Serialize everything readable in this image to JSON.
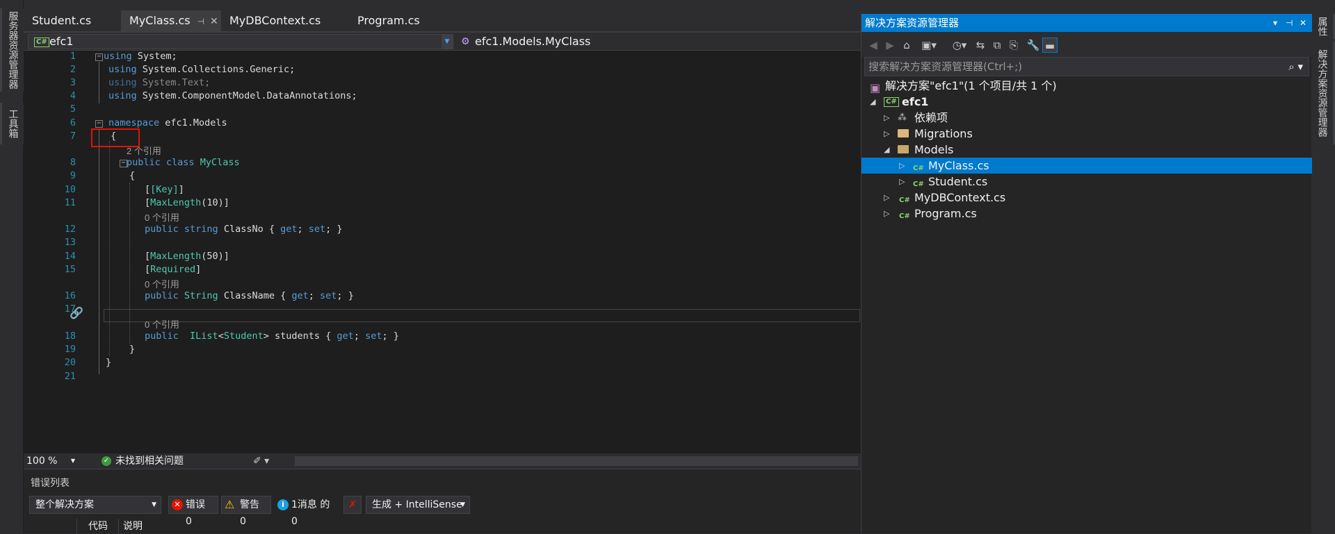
{
  "left_strip": {
    "tabs": [
      "服务器资源管理器",
      "工具箱"
    ]
  },
  "right_strip": {
    "tabs": [
      "属性",
      "解决方案资源管理器"
    ]
  },
  "doc_tabs": [
    {
      "label": "Student.cs",
      "active": false
    },
    {
      "label": "MyClass.cs",
      "active": true
    },
    {
      "label": "MyDBContext.cs",
      "active": false
    },
    {
      "label": "Program.cs",
      "active": false
    }
  ],
  "navbar": {
    "project": "efc1",
    "scope": "efc1.Models.MyClass"
  },
  "editor": {
    "line_numbers": [
      "1",
      "2",
      "3",
      "4",
      "5",
      "6",
      "7",
      "8",
      "9",
      "10",
      "11",
      "12",
      "13",
      "14",
      "15",
      "16",
      "17",
      "18",
      "19",
      "20",
      "21"
    ],
    "lens": {
      "refs2": "2 个引用",
      "refs0": "0 个引用"
    },
    "code": {
      "l1_kw": "using",
      "l1_rest": " System;",
      "l2_kw": "using",
      "l2_rest": " System.Collections.Generic;",
      "l3_kw": "using",
      "l3_rest": " System.Text;",
      "l4_kw": "using",
      "l4_rest": " System.ComponentModel.DataAnnotations;",
      "l6_kw": "namespace",
      "l6_rest": " efc1.Models",
      "open_brace": "{",
      "close_brace": "}",
      "l8_kw1": "public",
      "l8_kw2": "class",
      "l8_type": "MyClass",
      "l10": "[Key]",
      "l11_attr": "MaxLength",
      "l11_arg": "(10)]",
      "l12_kw1": "public",
      "l12_kw2": "string",
      "l12_rest": " ClassNo { ",
      "get": "get",
      "set": "set",
      "semi": "; ",
      "end": " }",
      "l14_attr": "MaxLength",
      "l14_arg": "(50)]",
      "l15": "Required",
      "l16_kw1": "public",
      "l16_type": "String",
      "l16_rest": " ClassName { ",
      "l18_kw1": "public",
      "l18_type1": "IList",
      "l18_type2": "Student",
      "l18_rest": " students { "
    }
  },
  "editor_status": {
    "zoom": "100 %",
    "issues": "未找到相关问题"
  },
  "error_list": {
    "title": "错误列表",
    "scope": "整个解决方案",
    "errors": "错误 0",
    "warnings": "警告 0",
    "messages": "1消息 的 0",
    "build": "生成 + IntelliSense",
    "col_code": "代码",
    "col_desc": "说明"
  },
  "solution_explorer": {
    "title": "解决方案资源管理器",
    "search_placeholder": "搜索解决方案资源管理器(Ctrl+;)",
    "solution": "解决方案\"efc1\"(1 个项目/共 1 个)",
    "project": "efc1",
    "deps": "依赖项",
    "migrations": "Migrations",
    "models": "Models",
    "myclass": "MyClass.cs",
    "student": "Student.cs",
    "dbcontext": "MyDBContext.cs",
    "program": "Program.cs"
  },
  "colors": {
    "accent": "#007acc",
    "keyword": "#569cd6",
    "type": "#4ec9b0",
    "linenum": "#2b91af",
    "highlight_box": "#e51400"
  }
}
